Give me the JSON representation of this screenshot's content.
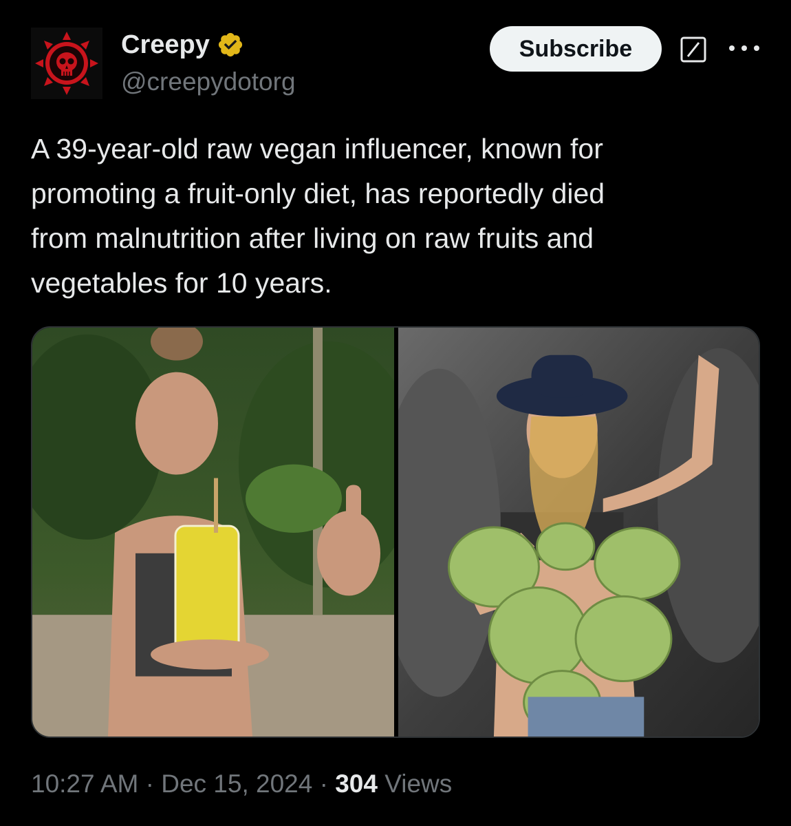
{
  "author": {
    "name": "Creepy",
    "handle": "@creepydotorg",
    "verified": true,
    "avatar_icon": "red-skull-gear-icon"
  },
  "header": {
    "subscribe_label": "Subscribe",
    "grok_icon": "slash-box-icon",
    "more_icon": "ellipsis-icon"
  },
  "tweet": {
    "text": "A 39-year-old raw vegan influencer, known for\npromoting a fruit-only diet, has reportedly died\nfrom malnutrition after living on raw fruits and\nvegetables for 10 years."
  },
  "media": {
    "images": [
      {
        "description_icon": "photo-woman-juice-thumbs-up"
      },
      {
        "description_icon": "photo-woman-coconuts-hat"
      }
    ]
  },
  "footer": {
    "time": "10:27 AM",
    "separator": " · ",
    "date": "Dec 15, 2024",
    "views_count": "304",
    "views_label": " Views"
  },
  "colors": {
    "background": "#000000",
    "primary_text": "#e7e9ea",
    "secondary_text": "#71767b",
    "verified_gold": "#e2b719",
    "subscribe_bg": "#eff3f4"
  }
}
